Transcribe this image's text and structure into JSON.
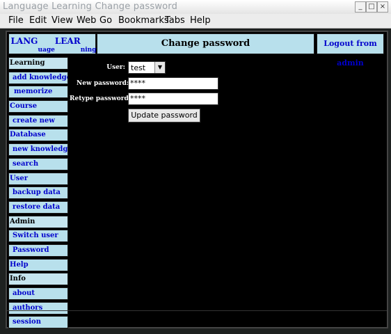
{
  "window": {
    "title": "Language Learning  Change password",
    "buttons": [
      "_",
      "□",
      "×"
    ]
  },
  "menu": {
    "items": [
      {
        "label": "File"
      },
      {
        "label": "Edit"
      },
      {
        "label": "View"
      },
      {
        "label": "Web"
      },
      {
        "label": "Go"
      },
      {
        "label": "Bookmarks"
      },
      {
        "label": "Tabs"
      },
      {
        "label": "Help"
      }
    ]
  },
  "header": {
    "logo_lang": "LANG",
    "logo_uage": "uage",
    "logo_lear": "LEAR",
    "logo_ning": "ning",
    "title": "Change password",
    "logout": "Logout from admin"
  },
  "sidebar": {
    "items": [
      {
        "label": "Learning",
        "kind": "section"
      },
      {
        "label": "add knowledges",
        "kind": "link"
      },
      {
        "label": "memorize",
        "kind": "link"
      },
      {
        "label": "Course",
        "kind": "section-link"
      },
      {
        "label": "create new",
        "kind": "link"
      },
      {
        "label": "Database",
        "kind": "section-link"
      },
      {
        "label": "new knowledges",
        "kind": "link"
      },
      {
        "label": "search",
        "kind": "link"
      },
      {
        "label": "User",
        "kind": "section-link"
      },
      {
        "label": "backup data",
        "kind": "link"
      },
      {
        "label": "restore data",
        "kind": "link"
      },
      {
        "label": "Admin",
        "kind": "section"
      },
      {
        "label": "Switch user",
        "kind": "link"
      },
      {
        "label": "Password",
        "kind": "link"
      },
      {
        "label": "Help",
        "kind": "section-link"
      },
      {
        "label": "Info",
        "kind": "section"
      },
      {
        "label": "about",
        "kind": "link"
      },
      {
        "label": "authors",
        "kind": "link"
      },
      {
        "label": "session",
        "kind": "link"
      }
    ]
  },
  "form": {
    "user_label": "User:",
    "user_value": "test",
    "new_password_label": "New password:",
    "new_password_value": "****",
    "retype_password_label": "Retype password:",
    "retype_password_value": "****",
    "submit_label": "Update password"
  }
}
